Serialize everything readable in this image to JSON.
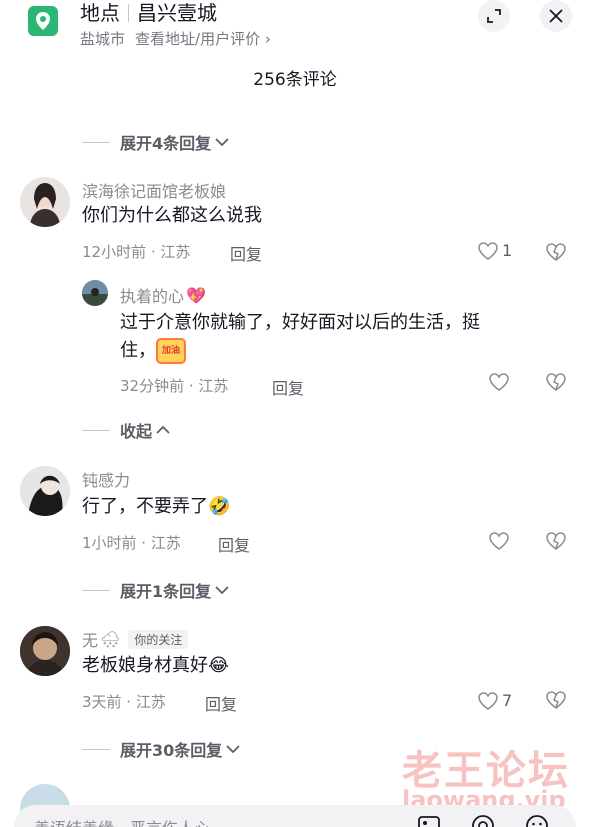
{
  "header": {
    "place_label": "地点",
    "place_name": "昌兴壹城",
    "city": "盐城市",
    "view_link": "查看地址/用户评价",
    "view_link_chevron": "›"
  },
  "comments_count": "256条评论",
  "toggles": {
    "expand_4": "展开4条回复",
    "collapse": "收起",
    "expand_1": "展开1条回复",
    "expand_30": "展开30条回复"
  },
  "comments": [
    {
      "name": "滨海徐记面馆老板娘",
      "text": "你们为什么都这么说我",
      "meta": "12小时前 · 江苏",
      "reply": "回复",
      "likes": "1"
    },
    {
      "name": "执着的心",
      "name_emoji": "💖",
      "text_line1": "过于介意你就输了，好好面对以后的生活，挺",
      "text_line2": "住，",
      "sticker_text": "加油",
      "meta": "32分钟前 · 江苏",
      "reply": "回复"
    },
    {
      "name": "钝感力",
      "text": "行了，不要弄了",
      "emoji": "🤣",
      "meta": "1小时前 · 江苏",
      "reply": "回复"
    },
    {
      "name": "无",
      "name_emoji": "🌨",
      "tag": "你的关注",
      "text": "老板娘身材真好",
      "emoji": "😂",
      "meta": "3天前 · 江苏",
      "reply": "回复",
      "likes": "7"
    }
  ],
  "input": {
    "placeholder": "善语结善缘，恶言伤人心"
  },
  "watermark": {
    "cn": "老王论坛",
    "url": "laowang.vip"
  },
  "colors": {
    "location_icon": "#2bb673",
    "text_primary": "#161823",
    "text_secondary": "#8a8b91",
    "watermark": "#ec5050"
  },
  "icons": [
    "location-pin-icon",
    "expand-icon",
    "close-icon",
    "chevron-down-icon",
    "chevron-up-icon",
    "heart-icon",
    "dislike-icon",
    "image-icon",
    "at-icon",
    "emoji-icon"
  ]
}
